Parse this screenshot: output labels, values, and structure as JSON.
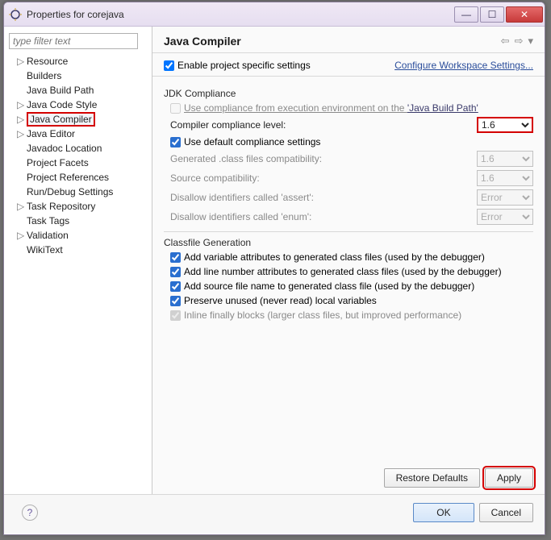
{
  "window": {
    "title": "Properties for corejava"
  },
  "sidebar": {
    "filter_placeholder": "type filter text",
    "items": [
      {
        "label": "Resource",
        "expandable": true
      },
      {
        "label": "Builders"
      },
      {
        "label": "Java Build Path"
      },
      {
        "label": "Java Code Style",
        "expandable": true
      },
      {
        "label": "Java Compiler",
        "highlight": true,
        "expandable": true
      },
      {
        "label": "Java Editor",
        "expandable": true
      },
      {
        "label": "Javadoc Location"
      },
      {
        "label": "Project Facets"
      },
      {
        "label": "Project References"
      },
      {
        "label": "Run/Debug Settings"
      },
      {
        "label": "Task Repository",
        "expandable": true
      },
      {
        "label": "Task Tags"
      },
      {
        "label": "Validation",
        "expandable": true
      },
      {
        "label": "WikiText"
      }
    ]
  },
  "main": {
    "heading": "Java Compiler",
    "enable_label": "Enable project specific settings",
    "configure_link": "Configure Workspace Settings...",
    "jdk": {
      "title": "JDK Compliance",
      "use_exec_prefix": "Use compliance from execution environment on the ",
      "use_exec_link": "'Java Build Path'",
      "level_label": "Compiler compliance level:",
      "level_value": "1.6",
      "use_default_label": "Use default compliance settings",
      "gen_class_label": "Generated .class files compatibility:",
      "gen_class_value": "1.6",
      "src_compat_label": "Source compatibility:",
      "src_compat_value": "1.6",
      "assert_label": "Disallow identifiers called 'assert':",
      "assert_value": "Error",
      "enum_label": "Disallow identifiers called 'enum':",
      "enum_value": "Error"
    },
    "classfile": {
      "title": "Classfile Generation",
      "var_attr": "Add variable attributes to generated class files (used by the debugger)",
      "line_num": "Add line number attributes to generated class files (used by the debugger)",
      "src_name": "Add source file name to generated class file (used by the debugger)",
      "preserve": "Preserve unused (never read) local variables",
      "inline": "Inline finally blocks (larger class files, but improved performance)"
    },
    "buttons": {
      "restore": "Restore Defaults",
      "apply": "Apply",
      "ok": "OK",
      "cancel": "Cancel"
    }
  }
}
